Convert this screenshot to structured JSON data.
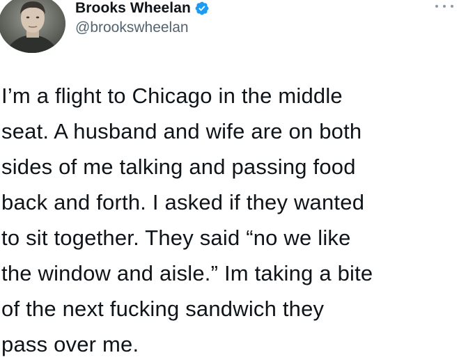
{
  "author": {
    "display_name": "Brooks Wheelan",
    "handle": "@brookswheelan",
    "verified": true,
    "verified_color": "#1d9bf0",
    "avatar_icon": "profile-photo"
  },
  "tweet": {
    "lines": [
      "I’m a flight to Chicago in the middle",
      "seat. A husband and wife are on both",
      "sides of me talking and passing food",
      "back and forth. I asked if they wanted",
      "to sit together. They said “no we like",
      "the window and aisle.” Im taking a bite",
      "of the next fucking sandwich they",
      "pass over me."
    ]
  },
  "menu": {
    "icon": "more-options-icon"
  }
}
